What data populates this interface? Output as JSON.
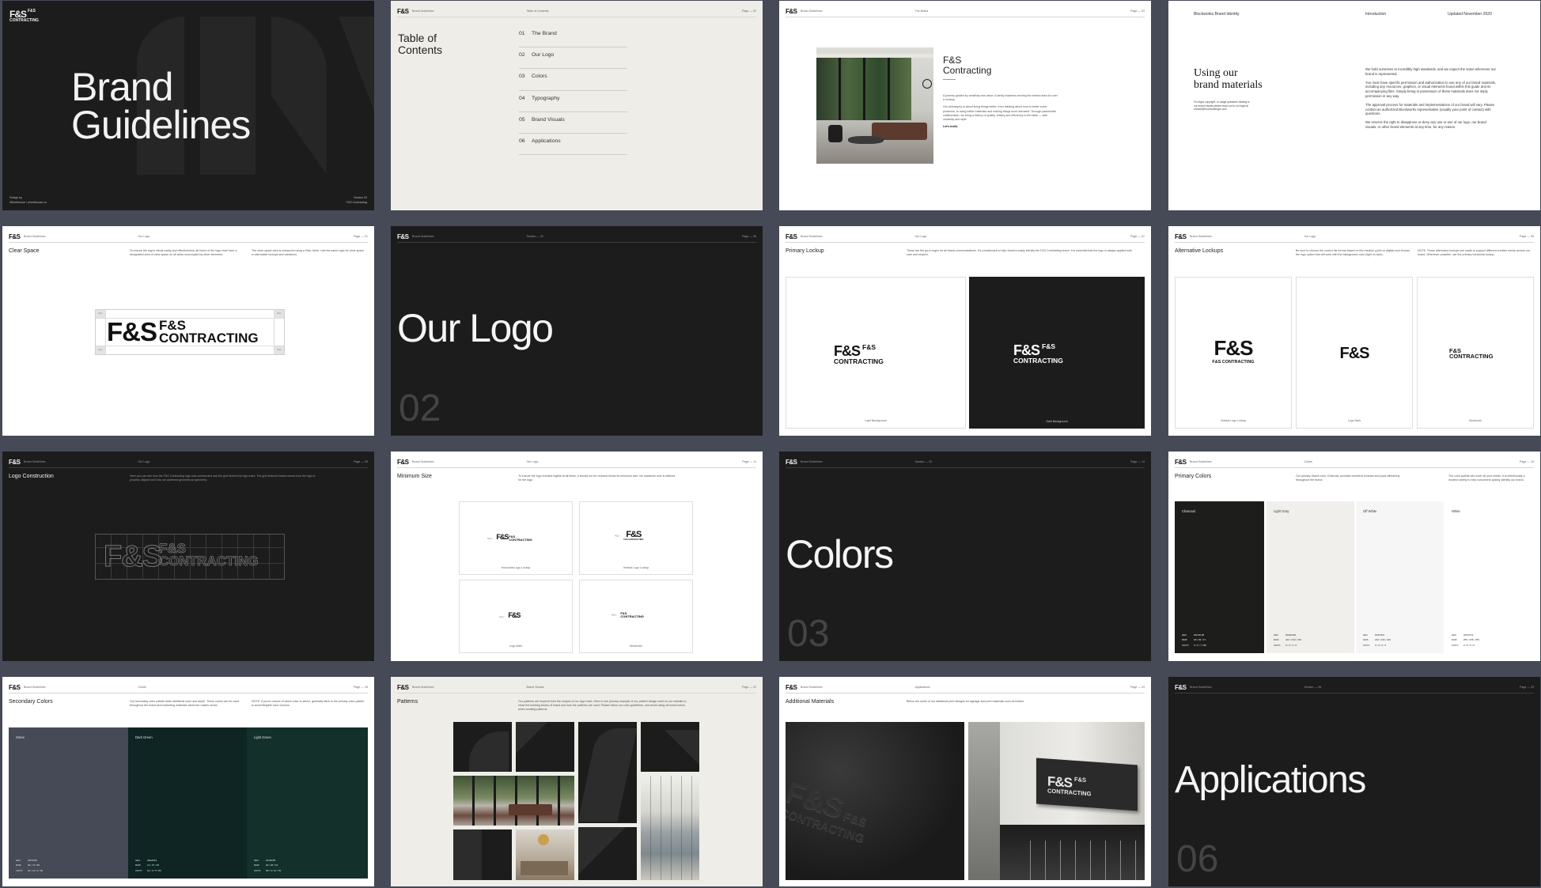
{
  "brand": {
    "logo": "F&S",
    "wordmark": "F&S CONTRACTING",
    "header_brand": "Brand Guidelines"
  },
  "cover": {
    "title_line1": "Brand",
    "title_line2": "Guidelines",
    "credit_line1": "Design by",
    "credit_line2": "Wheelhouse / wheelhouse.co",
    "version_line1": "Version 02",
    "version_line2": "F&S Contracting",
    "logo_line1": "F&S",
    "logo_line2": "CONTRACTING"
  },
  "toc": {
    "section": "Table of Contents",
    "page": "Page — 02",
    "title_line1": "Table of",
    "title_line2": "Contents",
    "items": [
      {
        "num": "01",
        "label": "The Brand"
      },
      {
        "num": "02",
        "label": "Our Logo"
      },
      {
        "num": "03",
        "label": "Colors"
      },
      {
        "num": "04",
        "label": "Typography"
      },
      {
        "num": "05",
        "label": "Brand Visuals"
      },
      {
        "num": "06",
        "label": "Applications"
      }
    ]
  },
  "brand_page": {
    "section": "The Brand",
    "page": "Page — 03",
    "name_line1": "F&S",
    "name_line2": "Contracting",
    "para1": "A journey guided by creativity and value. A family business serving the Ireland area for over a century.",
    "para2": "Our philosophy is about living things better, from thinking about how to better solve problems, to using better materials and making things more elevated. Through passionate collaboration, we bring a history of quality, artistry and efficiency to the table — with creativity and style.",
    "cta": "Let's build."
  },
  "using": {
    "hdr_left": "Blockworks Brand Identity",
    "hdr_mid": "Introduction",
    "hdr_right": "Updated November 2020",
    "title_line1": "Using our",
    "title_line2": "brand materials",
    "small": "For legal, copyright, or usage questions relating to our brand visuals please reach out to our legal at contact@fscontractingco.com",
    "para1": "We hold ourselves to incredibly high standards, and we expect the same whenever our brand is represented.",
    "para2": "You must have specific permission and authorization to use any of our brand materials, including any resources, graphics, or visual elements found within this guide and its accompanying files. Simply being in possession of these materials does not imply permission in any way.",
    "para3": "The approval process for materials and implementations of our brand will vary. Please contact an authorized Blockworks representative (usually your point of contact) with questions.",
    "para4": "We reserve the right to disapprove or deny any use or use of our logo, our brand visuals, or other brand elements at any time, for any reason."
  },
  "clear_space": {
    "section": "Our Logo",
    "page": "Page — 01",
    "title": "Clear Space",
    "body1": "To ensure the logo's visual clarity and effectiveness, all forms of the logo must have a designated area of clear space on all sides unoccupied by other elements.",
    "body2": "The clear space area is measured using a 90px block. Use the same logic for clear space in alternative lockups and variations.",
    "tag": "90px"
  },
  "our_logo": {
    "section": "Section — 02",
    "page": "Page — 06",
    "title": "Our Logo",
    "number": "02"
  },
  "primary_lockup": {
    "section": "Our Logo",
    "page": "Page — 07",
    "title": "Primary Lockup",
    "body": "These are the go-to logos for all brand communications. It's a trademark to help viewers easily identify the F&S Contracting brand. It is essential that the logo is always applied with care and respect.",
    "light": "Light Background",
    "dark": "Dark Background"
  },
  "alt_lockups": {
    "section": "Our Logo",
    "page": "Page — 08",
    "title": "Alternative Lockups",
    "body1": "Be sure to choose the correct file format based on the medium (print vs digital) and choose the logo option that will work with the background color (light vs dark).",
    "body2": "NOTE: These alternative lockups are made to support different creative needs across our brand. Whenever possible, use the primary horizontal lockup.",
    "a": "Vertical Logo Lockup",
    "b": "Logo Mark",
    "c": "Wordmark"
  },
  "construction": {
    "section": "Our Logo",
    "page": "Page — 09",
    "title": "Logo Construction",
    "body": "Here you can see how the F&S Contracting logo was constructed and the grid behind the logo mark. The grid featured below shows how the logo is properly aligned and how we achieved geometrical symmetry."
  },
  "min_size": {
    "section": "Our Logo",
    "page": "Page — 11",
    "title": "Minimum Size",
    "body": "To ensure the logo remains legible at all times, it should not be reduced below its minimum size. No maximum size is defined for the logo.",
    "a": "Horizontal Logo Lockup",
    "b": "Vertical Logo Lockup",
    "c": "Logo Mark",
    "d": "Wordmark",
    "s1": "60px",
    "s2": "40px",
    "s3": "32px",
    "s4": "80px"
  },
  "colors_title": {
    "section": "Section — 03",
    "page": "Page — 14",
    "title": "Colors",
    "number": "03"
  },
  "primary_colors": {
    "section": "Colors",
    "page": "Page — 15",
    "title": "Primary Colors",
    "body1": "Our primary brand color, Charcoal, provides excellent contrast and pops effectively throughout the brand.",
    "body2": "The color palette will cover all your needs. It is intentionally a modest variety to help consumers quickly identify our brand.",
    "swatches": [
      {
        "name": "Charcoal",
        "hex": "#1D1D1B",
        "rgb": "29 / 29 / 27",
        "cmyk": "0 / 0 / 7 / 89",
        "color": "#1d1d1b",
        "text": "#eeeeee"
      },
      {
        "name": "Light Gray",
        "hex": "#F0EFEB",
        "rgb": "240 / 239 / 235",
        "cmyk": "0 / 0 / 2 / 6",
        "color": "#f0efeb",
        "text": "#333333"
      },
      {
        "name": "Off White",
        "hex": "#F6F6F6",
        "rgb": "246 / 246 / 246",
        "cmyk": "0 / 0 / 0 / 4",
        "color": "#f6f6f6",
        "text": "#333333"
      },
      {
        "name": "White",
        "hex": "#FFFFFF",
        "rgb": "255 / 255 / 255",
        "cmyk": "0 / 0 / 0 / 0",
        "color": "#ffffff",
        "text": "#333333"
      }
    ],
    "hex_label": "HEX",
    "rgb_label": "RGB",
    "cmyk_label": "CMYK"
  },
  "secondary_colors": {
    "section": "Colors",
    "page": "Page — 16",
    "title": "Secondary Colors",
    "body1": "Our secondary color palette adds additional color and depth. These colors can be used throughout the brand and marketing materials wherever makes sense.",
    "body2": "NOTE: If you're unsure of which color to select, generally stick to the primary color palette to avoid illegible color choices.",
    "swatches": [
      {
        "name": "Stone",
        "hex": "#454A56",
        "rgb": "69 / 74 / 86",
        "cmyk": "20 / 14 / 0 / 66",
        "color": "#454a56"
      },
      {
        "name": "Dark Green",
        "hex": "#0E2523",
        "rgb": "14 / 37 / 35",
        "cmyk": "62 / 0 / 5 / 85",
        "color": "#0e2523"
      },
      {
        "name": "Light Green",
        "hex": "#14302B",
        "rgb": "20 / 48 / 43",
        "cmyk": "58 / 0 / 10 / 81",
        "color": "#14302b"
      }
    ]
  },
  "patterns": {
    "section": "Brand Visuals",
    "page": "Page — 22",
    "title": "Patterns",
    "body": "Our patterns are inspired from the shapes of our logo mark. Here is one primary example of our pattern design used on our website to show the building blocks of brand and how the patterns are used. Please follow our color guidelines, and avoid using off-brand colors when creating patterns."
  },
  "additional": {
    "section": "Applications",
    "page": "Page — 24",
    "title": "Additional Materials",
    "body": "Below are some of our additional print designs for signage and print materials such as folders."
  },
  "applications": {
    "section": "Section — 06",
    "page": "Page — 23",
    "title": "Applications",
    "number": "06"
  },
  "colors": {
    "charcoal": "#1c1c1c",
    "offwhite": "#efede8",
    "page_bg": "#454a56"
  }
}
